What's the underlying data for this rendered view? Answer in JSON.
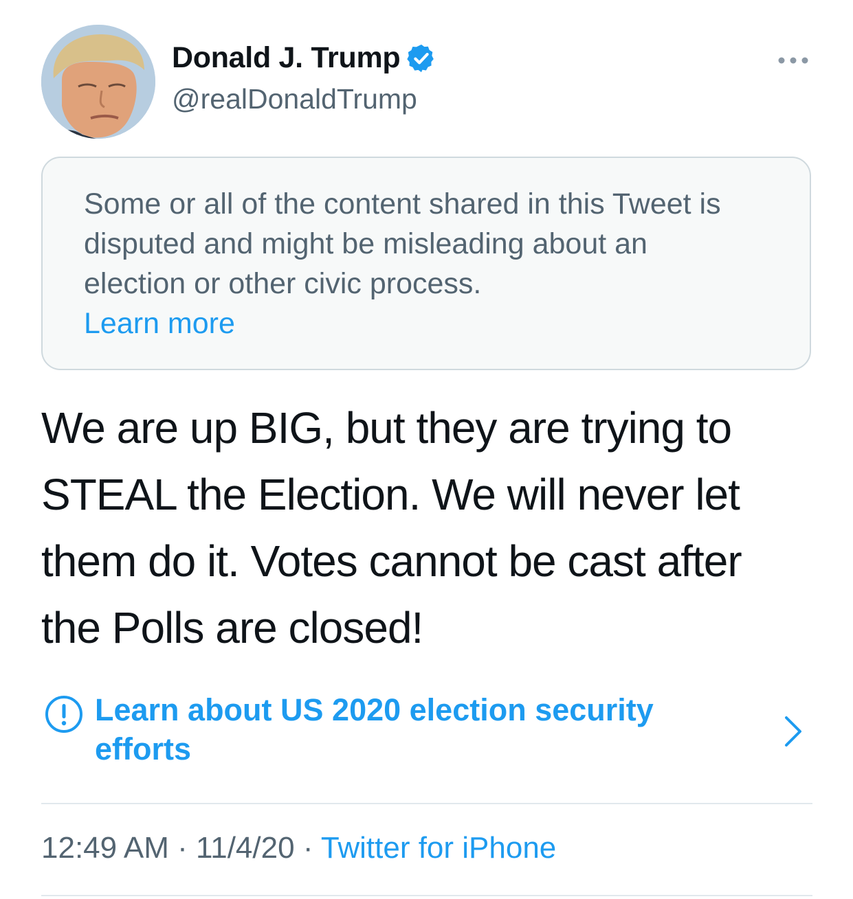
{
  "author": {
    "display_name": "Donald J. Trump",
    "handle": "@realDonaldTrump",
    "avatar_icon": "profile-photo",
    "verified_icon": "verified-badge-icon"
  },
  "menu": {
    "more_icon": "more-horizontal-icon"
  },
  "notice": {
    "text": "Some or all of the content shared in this Tweet is disputed and might be misleading about an election or other civic process.",
    "link_label": "Learn more"
  },
  "tweet": {
    "text": "We are up BIG, but they are trying to STEAL the Election. We will never let them do it. Votes cannot be cast after the Polls are closed!"
  },
  "election_link": {
    "icon": "info-icon",
    "label": "Learn about US 2020 election security efforts",
    "chevron_icon": "chevron-right-icon"
  },
  "meta": {
    "time": "12:49 AM",
    "separator": "·",
    "date": "11/4/20",
    "source": "Twitter for iPhone"
  },
  "colors": {
    "accent": "#1d9bf0",
    "secondary_text": "#536471",
    "primary_text": "#0f1419",
    "notice_background": "#f7f9f9",
    "border": "#cfd9de"
  }
}
